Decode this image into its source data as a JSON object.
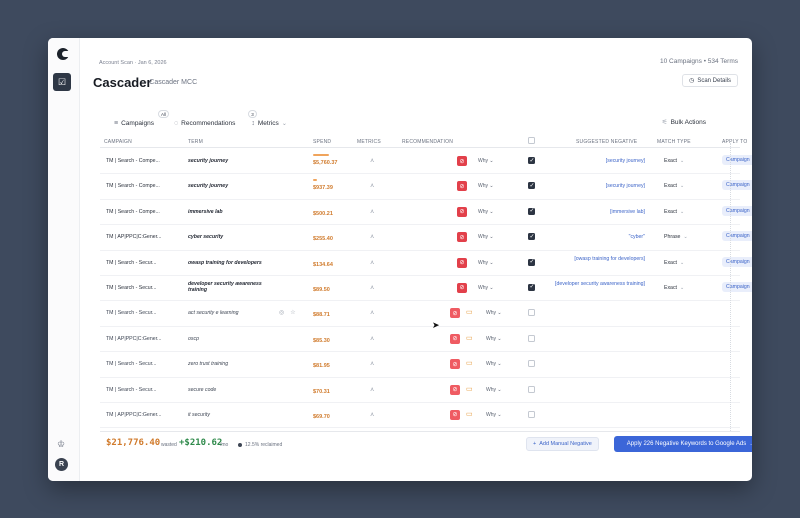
{
  "header": {
    "scan_meta": "Account Scan · Jan 6, 2026",
    "counts": "10 Campaigns • 534 Terms",
    "title": "Cascader",
    "subtitle": "· Cascader MCC",
    "scan_details": "Scan Details"
  },
  "tabs": [
    {
      "label": "Campaigns",
      "badge": "All"
    },
    {
      "label": "Recommendations",
      "badge": "3"
    },
    {
      "label": "Metrics",
      "badge": ""
    }
  ],
  "bulk_actions": "Bulk Actions",
  "columns": {
    "campaign": "CAMPAIGN",
    "term": "TERM",
    "spend": "SPEND",
    "metrics": "METRICS",
    "recommendation": "RECOMMENDATION",
    "suggested": "SUGGESTED NEGATIVE",
    "match": "MATCH TYPE",
    "apply": "APPLY TO"
  },
  "why_label": "Why",
  "rows": [
    {
      "campaign": "TM | Search - Compe...",
      "term": "security journey",
      "spend": "$5,760.37",
      "checked": true,
      "negative": "[security journey]",
      "match": "Exact",
      "apply": "Campaign"
    },
    {
      "campaign": "TM | Search - Compe...",
      "term": "security journey",
      "spend": "$937.39",
      "checked": true,
      "negative": "[security journey]",
      "match": "Exact",
      "apply": "Campaign"
    },
    {
      "campaign": "TM | Search - Compe...",
      "term": "immersive lab",
      "spend": "$500.21",
      "checked": true,
      "negative": "[immersive lab]",
      "match": "Exact",
      "apply": "Campaign"
    },
    {
      "campaign": "TM | AP|PPC|C:Gener...",
      "term": "cyber security",
      "spend": "$255.40",
      "checked": true,
      "negative": "\"cyber\"",
      "match": "Phrase",
      "apply": "Campaign"
    },
    {
      "campaign": "TM | Search - Secur...",
      "term": "owasp training for developers",
      "spend": "$134.64",
      "checked": true,
      "negative": "[owasp training for developers]",
      "match": "Exact",
      "apply": "Campaign"
    },
    {
      "campaign": "TM | Search - Secur...",
      "term": "developer security awareness training",
      "spend": "$89.50",
      "checked": true,
      "negative": "[developer security awareness training]",
      "match": "Exact",
      "apply": "Campaign"
    },
    {
      "campaign": "TM | Search - Secur...",
      "term": "act security e learning",
      "spend": "$88.71",
      "checked": false
    },
    {
      "campaign": "TM | AP|PPC|C:Gener...",
      "term": "oscp",
      "spend": "$85.30",
      "checked": false
    },
    {
      "campaign": "TM | Search - Secur...",
      "term": "zero trust training",
      "spend": "$81.95",
      "checked": false
    },
    {
      "campaign": "TM | Search - Secur...",
      "term": "secure code",
      "spend": "$70.31",
      "checked": false
    },
    {
      "campaign": "TM | AP|PPC|C:Gener...",
      "term": "it security",
      "spend": "$69.70",
      "checked": false
    }
  ],
  "footer": {
    "wasted": "$21,776.40",
    "wasted_label": "wasted",
    "savings": "+$210.62",
    "savings_label": "/mo",
    "reclaimed": "12.5% reclaimed",
    "add_manual": "Add Manual Negative",
    "apply_button": "Apply 226 Negative Keywords to Google Ads"
  },
  "user_initial": "R",
  "colors": {
    "accent": "#3b66d8",
    "warning": "#d07a2b",
    "danger": "#e2404a",
    "success": "#2f8a4b"
  }
}
